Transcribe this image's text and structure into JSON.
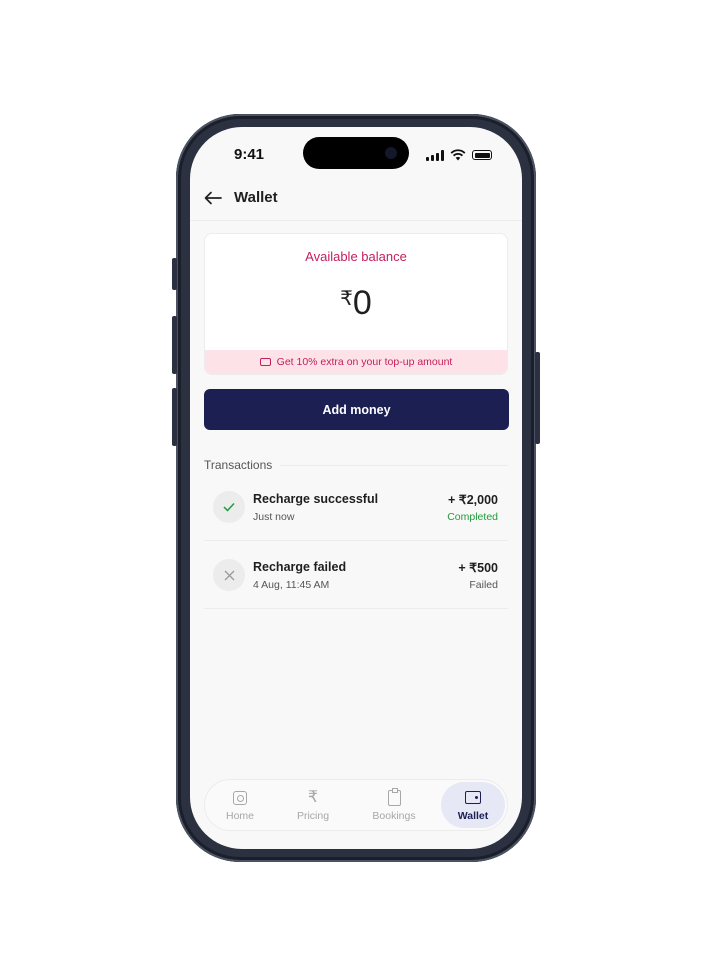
{
  "status_bar": {
    "time": "9:41"
  },
  "header": {
    "title": "Wallet",
    "back_icon": "arrow-left-icon"
  },
  "balance": {
    "label": "Available balance",
    "currency": "₹",
    "amount": "0",
    "promo_text": "Get 10% extra on your top-up amount",
    "promo_icon": "wallet-outline-icon"
  },
  "actions": {
    "add_money_label": "Add money"
  },
  "transactions": {
    "title": "Transactions",
    "items": [
      {
        "icon": "check-icon",
        "name": "Recharge successful",
        "time": "Just now",
        "amount": "+ ₹2,000",
        "status": "Completed",
        "status_color": "#1f9d3a"
      },
      {
        "icon": "x-icon",
        "name": "Recharge failed",
        "time": "4 Aug, 11:45 AM",
        "amount": "+ ₹500",
        "status": "Failed",
        "status_color": "#555555"
      }
    ]
  },
  "tabbar": {
    "items": [
      {
        "label": "Home",
        "icon": "home-icon"
      },
      {
        "label": "Pricing",
        "icon": "rupee-icon"
      },
      {
        "label": "Bookings",
        "icon": "clipboard-icon"
      },
      {
        "label": "Wallet",
        "icon": "wallet-icon",
        "active": true
      }
    ]
  },
  "colors": {
    "accent": "#1b1f52",
    "brand_pink": "#c41f5e",
    "promo_bg": "#fde3e8",
    "success": "#1f9d3a"
  }
}
